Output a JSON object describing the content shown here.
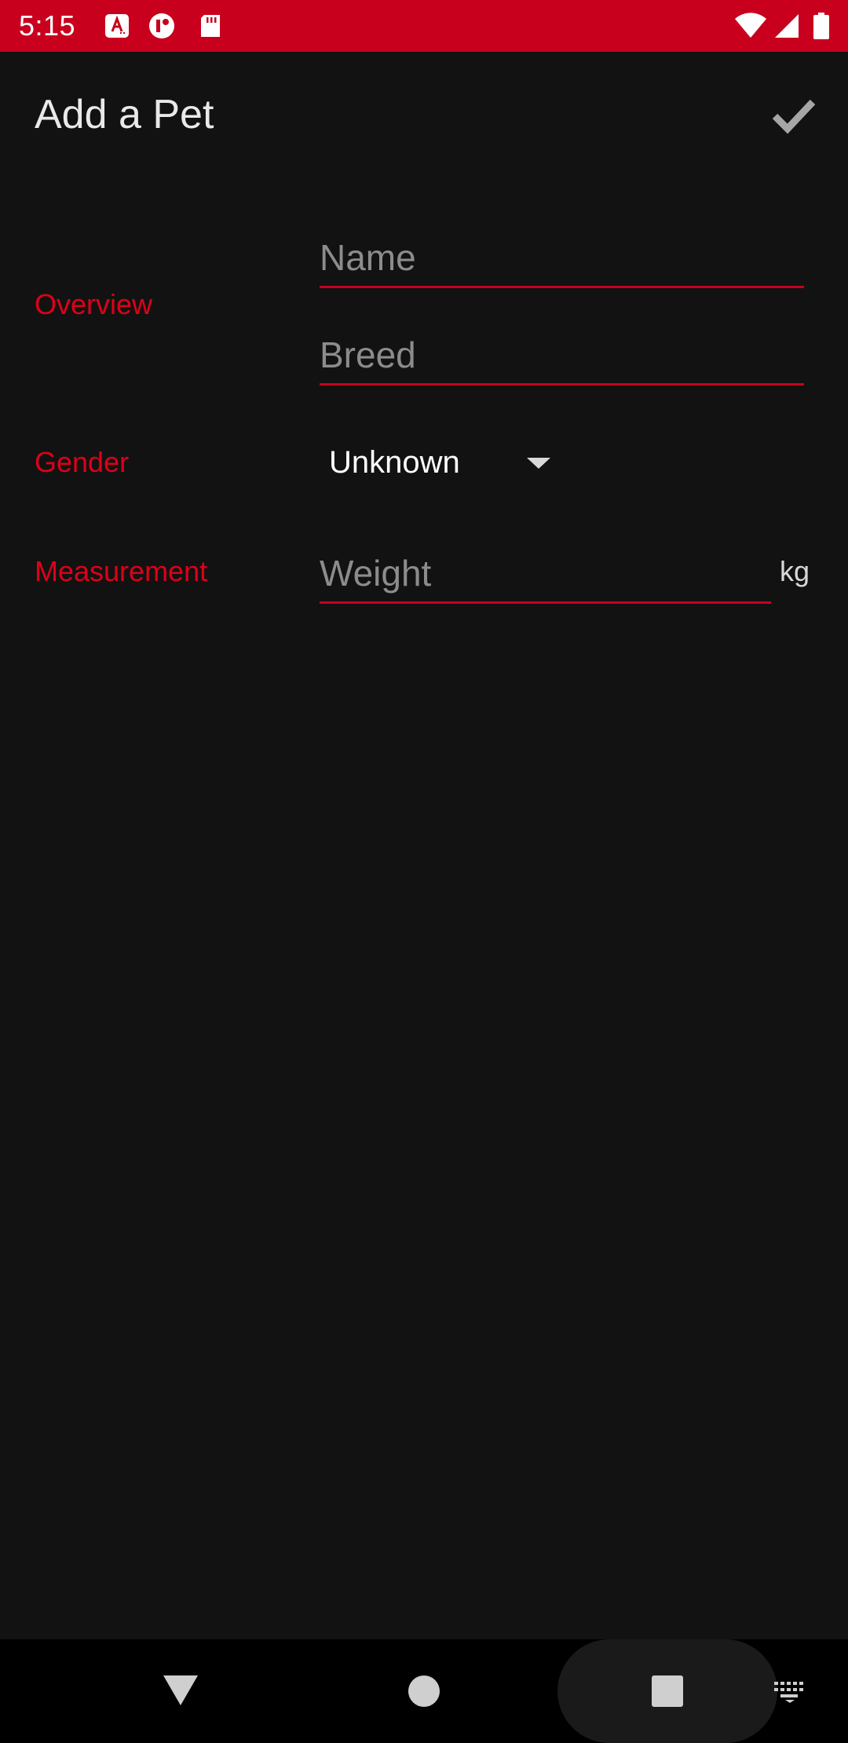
{
  "status_bar": {
    "time": "5:15",
    "background": "#c8001d",
    "icons": [
      "accessibility-app-icon",
      "notification-app-icon",
      "sd-card-icon",
      "wifi-icon",
      "cell-signal-icon",
      "battery-icon"
    ]
  },
  "app_bar": {
    "title": "Add a Pet",
    "action_icon": "checkmark-icon"
  },
  "form": {
    "overview": {
      "label": "Overview",
      "name_placeholder": "Name",
      "name_value": "",
      "breed_placeholder": "Breed",
      "breed_value": ""
    },
    "gender": {
      "label": "Gender",
      "selected": "Unknown"
    },
    "measurement": {
      "label": "Measurement",
      "weight_placeholder": "Weight",
      "weight_value": "",
      "unit": "kg"
    }
  },
  "nav_bar": {
    "icons": [
      "back-icon",
      "home-icon",
      "recents-icon",
      "keyboard-icon"
    ]
  },
  "colors": {
    "accent": "#dd0019",
    "underline": "#c8001d",
    "background": "#121212"
  }
}
